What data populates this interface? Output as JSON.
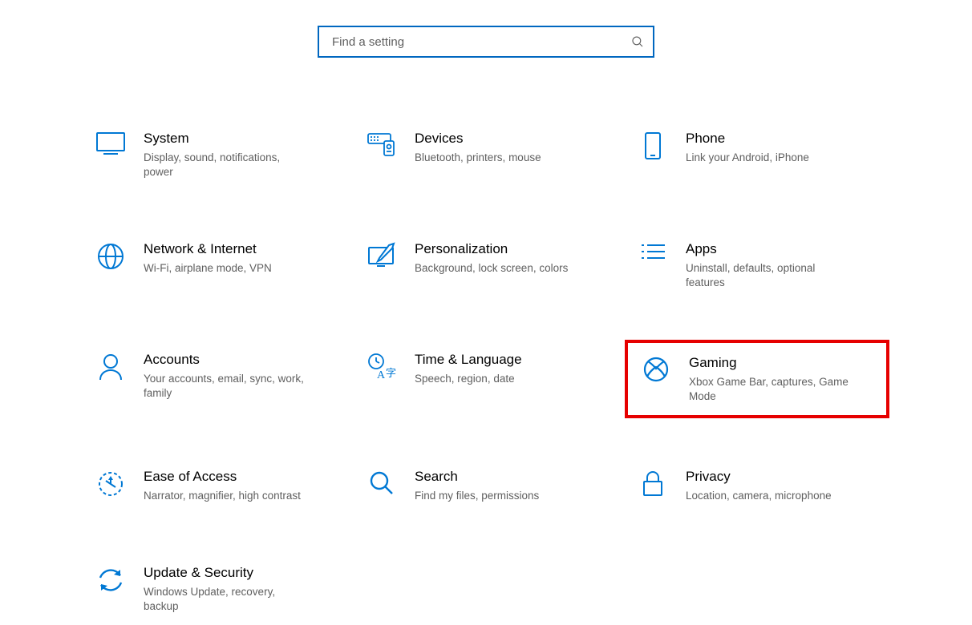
{
  "search": {
    "placeholder": "Find a setting"
  },
  "tiles": {
    "system": {
      "title": "System",
      "desc": "Display, sound, notifications, power"
    },
    "devices": {
      "title": "Devices",
      "desc": "Bluetooth, printers, mouse"
    },
    "phone": {
      "title": "Phone",
      "desc": "Link your Android, iPhone"
    },
    "network": {
      "title": "Network & Internet",
      "desc": "Wi-Fi, airplane mode, VPN"
    },
    "personalization": {
      "title": "Personalization",
      "desc": "Background, lock screen, colors"
    },
    "apps": {
      "title": "Apps",
      "desc": "Uninstall, defaults, optional features"
    },
    "accounts": {
      "title": "Accounts",
      "desc": "Your accounts, email, sync, work, family"
    },
    "time": {
      "title": "Time & Language",
      "desc": "Speech, region, date"
    },
    "gaming": {
      "title": "Gaming",
      "desc": "Xbox Game Bar, captures, Game Mode"
    },
    "ease": {
      "title": "Ease of Access",
      "desc": "Narrator, magnifier, high contrast"
    },
    "search_tile": {
      "title": "Search",
      "desc": "Find my files, permissions"
    },
    "privacy": {
      "title": "Privacy",
      "desc": "Location, camera, microphone"
    },
    "update": {
      "title": "Update & Security",
      "desc": "Windows Update, recovery, backup"
    }
  },
  "colors": {
    "accent": "#0067c0",
    "iconBlue": "#0078d4",
    "highlight": "#e60000"
  }
}
